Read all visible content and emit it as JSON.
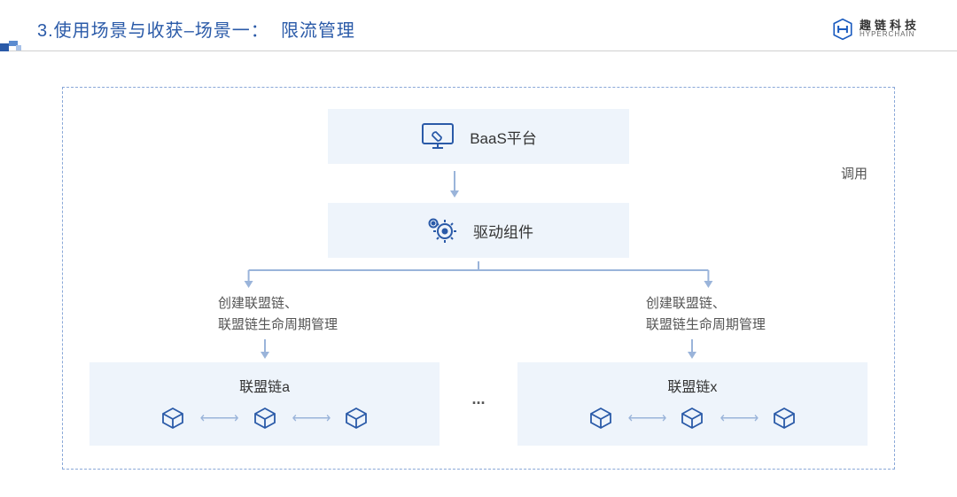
{
  "header": {
    "title_prefix": "3.使用场景与收获",
    "title_sep": "–场景一：",
    "title_topic": "限流管理"
  },
  "logo": {
    "cn": "趣链科技",
    "en": "HYPERCHAIN"
  },
  "diagram": {
    "baas": "BaaS平台",
    "call": "调用",
    "driver": "驱动组件",
    "branch_text1": "创建联盟链、",
    "branch_text2": "联盟链生命周期管理",
    "chain_a": "联盟链a",
    "chain_x": "联盟链x",
    "ellipsis": "..."
  }
}
